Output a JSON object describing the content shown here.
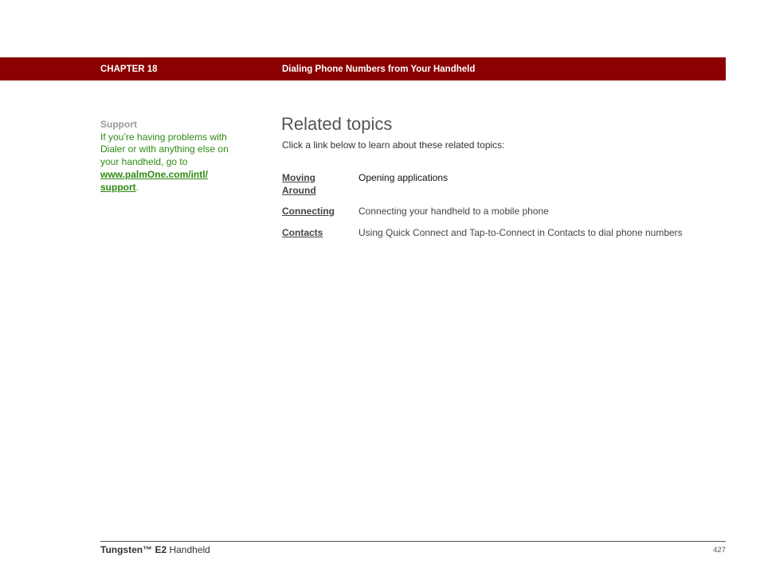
{
  "header": {
    "chapter": "CHAPTER 18",
    "title": "Dialing Phone Numbers from Your Handheld"
  },
  "sidebar": {
    "heading": "Support",
    "text": "If you’re having problems with Dialer or with anything else on your handheld, go to",
    "link": "www.palmOne.com/intl/support",
    "link_line1": "www.palmOne.com/intl/",
    "link_line2": "support",
    "trailing": "."
  },
  "main": {
    "title": "Related topics",
    "intro": "Click a link below to learn about these related topics:",
    "topics": [
      {
        "link_line1": "Moving ",
        "link_line2": "Around",
        "description": "Opening applications"
      },
      {
        "link": "Connecting",
        "description": "Connecting your handheld to a mobile phone"
      },
      {
        "link": "Contacts",
        "description": "Using Quick Connect and Tap-to-Connect in Contacts to dial phone numbers"
      }
    ]
  },
  "footer": {
    "product_bold": "Tungsten™ E2",
    "product_rest": " Handheld",
    "page_number": "427"
  },
  "colors": {
    "header_bar": "#8b0000",
    "sidebar_text": "#2e8b13",
    "sidebar_heading": "#9a9a9a"
  }
}
